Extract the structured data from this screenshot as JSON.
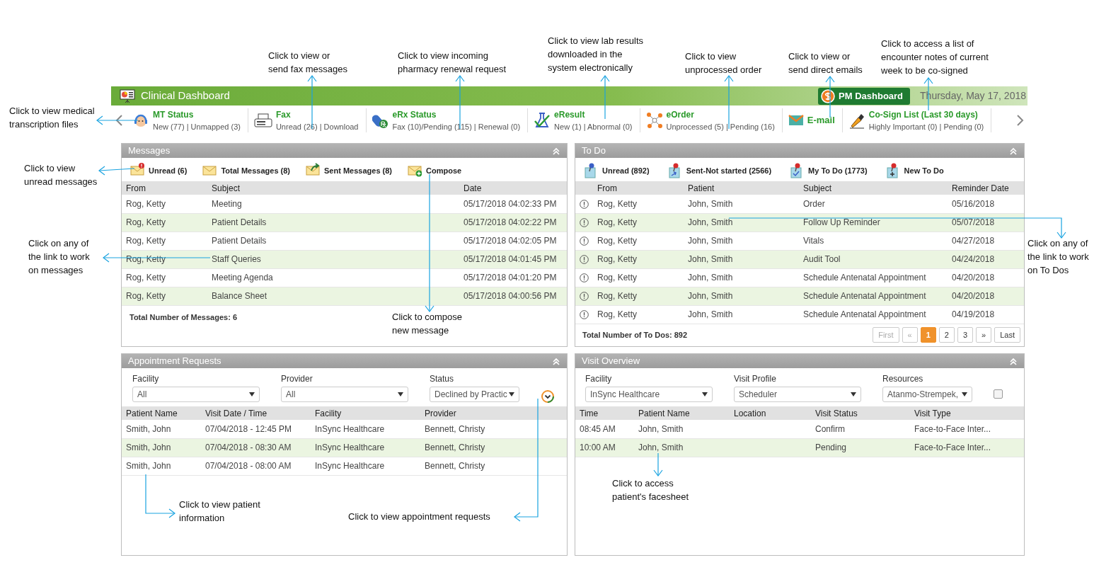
{
  "header": {
    "title": "Clinical Dashboard",
    "pm_button": "PM Dashboard",
    "date": "Thursday, May 17, 2018"
  },
  "status_items": [
    {
      "title": "MT Status",
      "detail": "New (77) | Unmapped (3)"
    },
    {
      "title": "Fax",
      "detail": "Unread (26) | Download"
    },
    {
      "title": "eRx Status",
      "detail": "Fax (10)/Pending (115) | Renewal (0)"
    },
    {
      "title": "eResult",
      "detail": "New (1) | Abnormal (0)"
    },
    {
      "title": "eOrder",
      "detail": "Unprocessed (5) | Pending (16)"
    },
    {
      "title": "E-mail"
    },
    {
      "title": "Co-Sign List (Last 30 days)",
      "detail": "Highly Important (0) | Pending (0)"
    }
  ],
  "messages": {
    "title": "Messages",
    "actions": [
      "Unread (6)",
      "Total Messages (8)",
      "Sent Messages (8)",
      "Compose"
    ],
    "columns": [
      "From",
      "Subject",
      "Date"
    ],
    "rows": [
      {
        "from": "Rog, Ketty",
        "subject": "Meeting",
        "date": "05/17/2018 04:02:33 PM"
      },
      {
        "from": "Rog, Ketty",
        "subject": "Patient Details",
        "date": "05/17/2018 04:02:22 PM"
      },
      {
        "from": "Rog, Ketty",
        "subject": "Patient Details",
        "date": "05/17/2018 04:02:05 PM"
      },
      {
        "from": "Rog, Ketty",
        "subject": "Staff Queries",
        "date": "05/17/2018 04:01:45 PM"
      },
      {
        "from": "Rog, Ketty",
        "subject": "Meeting Agenda",
        "date": "05/17/2018 04:01:20 PM"
      },
      {
        "from": "Rog, Ketty",
        "subject": "Balance Sheet",
        "date": "05/17/2018 04:00:56 PM"
      }
    ],
    "footer": "Total Number of Messages: 6"
  },
  "todo": {
    "title": "To Do",
    "actions": [
      "Unread (892)",
      "Sent-Not started (2566)",
      "My To Do (1773)",
      "New To Do"
    ],
    "columns": [
      "From",
      "Patient",
      "Subject",
      "Reminder Date"
    ],
    "rows": [
      {
        "from": "Rog, Ketty",
        "patient": "John, Smith",
        "subject": "Order",
        "date": "05/16/2018"
      },
      {
        "from": "Rog, Ketty",
        "patient": "John, Smith",
        "subject": "Follow Up Reminder",
        "date": "05/07/2018"
      },
      {
        "from": "Rog, Ketty",
        "patient": "John, Smith",
        "subject": "Vitals",
        "date": "04/27/2018"
      },
      {
        "from": "Rog, Ketty",
        "patient": "John, Smith",
        "subject": "Audit Tool",
        "date": "04/24/2018"
      },
      {
        "from": "Rog, Ketty",
        "patient": "John, Smith",
        "subject": "Schedule Antenatal Appointment",
        "date": "04/20/2018"
      },
      {
        "from": "Rog, Ketty",
        "patient": "John, Smith",
        "subject": "Schedule Antenatal Appointment",
        "date": "04/20/2018"
      },
      {
        "from": "Rog, Ketty",
        "patient": "John, Smith",
        "subject": "Schedule Antenatal Appointment",
        "date": "04/19/2018"
      }
    ],
    "footer": "Total Number of To Dos: 892",
    "pagination": [
      {
        "label": "First",
        "selected": false,
        "disabled": true
      },
      {
        "label": "«",
        "selected": false,
        "disabled": true
      },
      {
        "label": "1",
        "selected": true,
        "disabled": false
      },
      {
        "label": "2",
        "selected": false,
        "disabled": false
      },
      {
        "label": "3",
        "selected": false,
        "disabled": false
      },
      {
        "label": "»",
        "selected": false,
        "disabled": false
      },
      {
        "label": "Last",
        "selected": false,
        "disabled": false
      }
    ]
  },
  "appointments": {
    "title": "Appointment Requests",
    "filters": [
      {
        "label": "Facility",
        "value": "All"
      },
      {
        "label": "Provider",
        "value": "All"
      },
      {
        "label": "Status",
        "value": "Declined by Practic"
      }
    ],
    "columns": [
      "Patient Name",
      "Visit Date / Time",
      "Facility",
      "Provider"
    ],
    "rows": [
      {
        "patient": "Smith, John",
        "visit": "07/04/2018 - 12:45 PM",
        "facility": "InSync Healthcare",
        "provider": "Bennett, Christy"
      },
      {
        "patient": "Smith, John",
        "visit": "07/04/2018 - 08:30 AM",
        "facility": "InSync Healthcare",
        "provider": "Bennett, Christy"
      },
      {
        "patient": "Smith, John",
        "visit": "07/04/2018 - 08:00 AM",
        "facility": "InSync Healthcare",
        "provider": "Bennett, Christy"
      }
    ]
  },
  "visits": {
    "title": "Visit Overview",
    "filters": [
      {
        "label": "Facility",
        "value": "InSync Healthcare"
      },
      {
        "label": "Visit Profile",
        "value": "Scheduler"
      },
      {
        "label": "Resources",
        "value": "Atanmo-Strempek,"
      }
    ],
    "checkbox": {
      "checked": false
    },
    "columns": [
      "Time",
      "Patient Name",
      "Location",
      "Visit Status",
      "Visit Type"
    ],
    "rows": [
      {
        "time": "08:45 AM",
        "patient": "John, Smith",
        "status": "Confirm",
        "type": "Face-to-Face Inter..."
      },
      {
        "time": "10:00 AM",
        "patient": "John, Smith",
        "status": "Pending",
        "type": "Face-to-Face Inter..."
      }
    ]
  },
  "annotations": [
    "Click to view medical\ntranscription files",
    "Click to view or\nsend fax messages",
    "Click to view incoming\npharmacy renewal request",
    "Click to view lab results\ndownloaded in the\nsystem electronically",
    "Click to view\nunprocessed order",
    "Click to view or\nsend direct emails",
    "Click to access a list of\nencounter notes of current\nweek to be co-signed",
    "Click to view\nunread messages",
    "Click on any of\nthe link to work\non messages",
    "Click to compose\nnew message",
    "Click on any of\nthe link to work\non To Dos",
    "Click to view patient\ninformation",
    "Click to view appointment requests",
    "Click to access\npatient's facesheet"
  ]
}
